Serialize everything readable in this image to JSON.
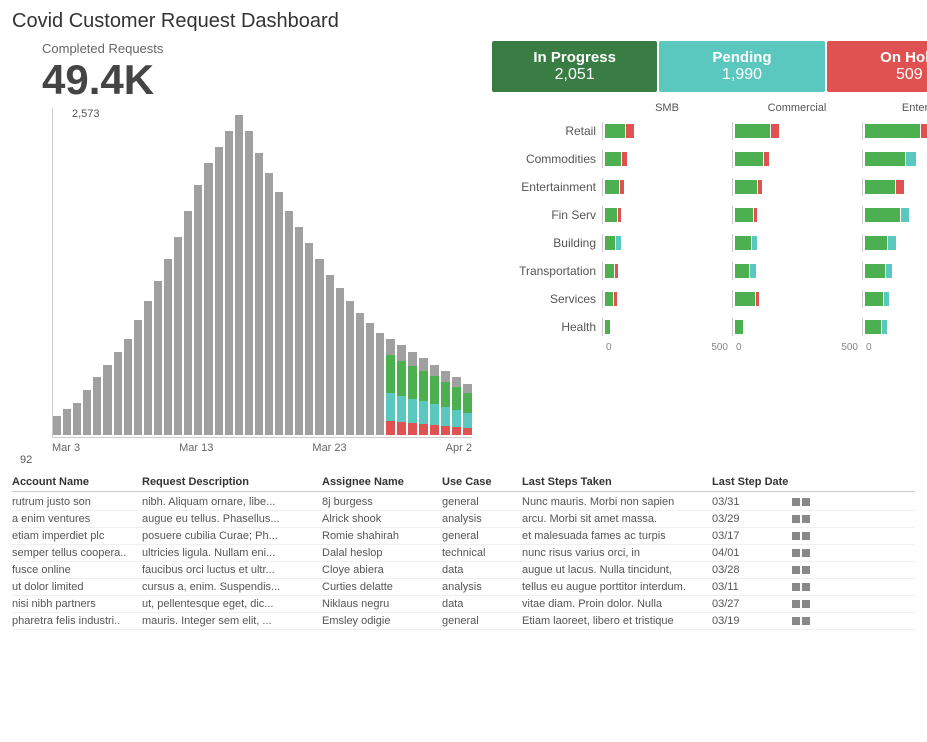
{
  "title": "Covid Customer Request Dashboard",
  "completed": {
    "label": "Completed Requests",
    "value": "49.4K"
  },
  "status_cards": [
    {
      "id": "in-progress",
      "label": "In Progress",
      "value": "2,051",
      "class": "in-progress"
    },
    {
      "id": "pending",
      "label": "Pending",
      "value": "1,990",
      "class": "pending"
    },
    {
      "id": "on-hold",
      "label": "On Hold",
      "value": "509",
      "class": "on-hold"
    }
  ],
  "segment_headers": [
    "SMB",
    "Commercial",
    "Enterprise"
  ],
  "segment_rows": [
    {
      "label": "Retail"
    },
    {
      "label": "Commodities"
    },
    {
      "label": "Entertainment"
    },
    {
      "label": "Fin Serv"
    },
    {
      "label": "Building"
    },
    {
      "label": "Transportation"
    },
    {
      "label": "Services"
    },
    {
      "label": "Health"
    }
  ],
  "x_axis_labels": [
    "Mar 3",
    "Mar 13",
    "Mar 23",
    "Apr 2"
  ],
  "chart_peak": "2,573",
  "chart_bottom": "92",
  "table": {
    "headers": [
      "Account Name",
      "Request Description",
      "Assignee Name",
      "Use Case",
      "Last Steps Taken",
      "Last Step Date"
    ],
    "rows": [
      [
        "rutrum justo  son",
        "nibh. Aliquam ornare, libe...",
        "8j burgess",
        "general",
        "Nunc mauris. Morbi non sapien",
        "03/31"
      ],
      [
        "a enim ventures",
        "augue eu tellus. Phasellus...",
        "Alrick shook",
        "analysis",
        "arcu. Morbi sit amet massa.",
        "03/29"
      ],
      [
        "etiam imperdiet plc",
        "posuere cubilia Curae; Ph...",
        "Romie shahirah",
        "general",
        "et malesuada fames ac turpis",
        "03/17"
      ],
      [
        "semper tellus coopera..",
        "ultricies ligula. Nullam eni...",
        "Dalal heslop",
        "technical",
        "nunc risus varius orci, in",
        "04/01"
      ],
      [
        "fusce online",
        "faucibus orci luctus et ultr...",
        "Cloye abiera",
        "data",
        "augue ut lacus. Nulla tincidunt,",
        "03/28"
      ],
      [
        "ut dolor limited",
        "cursus a, enim. Suspendis...",
        "Curties delatte",
        "analysis",
        "tellus eu augue porttitor interdum.",
        "03/11"
      ],
      [
        "nisi nibh partners",
        "ut, pellentesque eget, dic...",
        "Niklaus negru",
        "data",
        "vitae diam. Proin dolor. Nulla",
        "03/27"
      ],
      [
        "pharetra felis industri..",
        "mauris. Integer sem elit, ...",
        "Emsley odigie",
        "general",
        "Etiam laoreet, libero et tristique",
        "03/19"
      ]
    ]
  },
  "colors": {
    "green": "#4caf50",
    "teal": "#5bc8c0",
    "red": "#e05252",
    "gray": "#a0a0a0"
  }
}
